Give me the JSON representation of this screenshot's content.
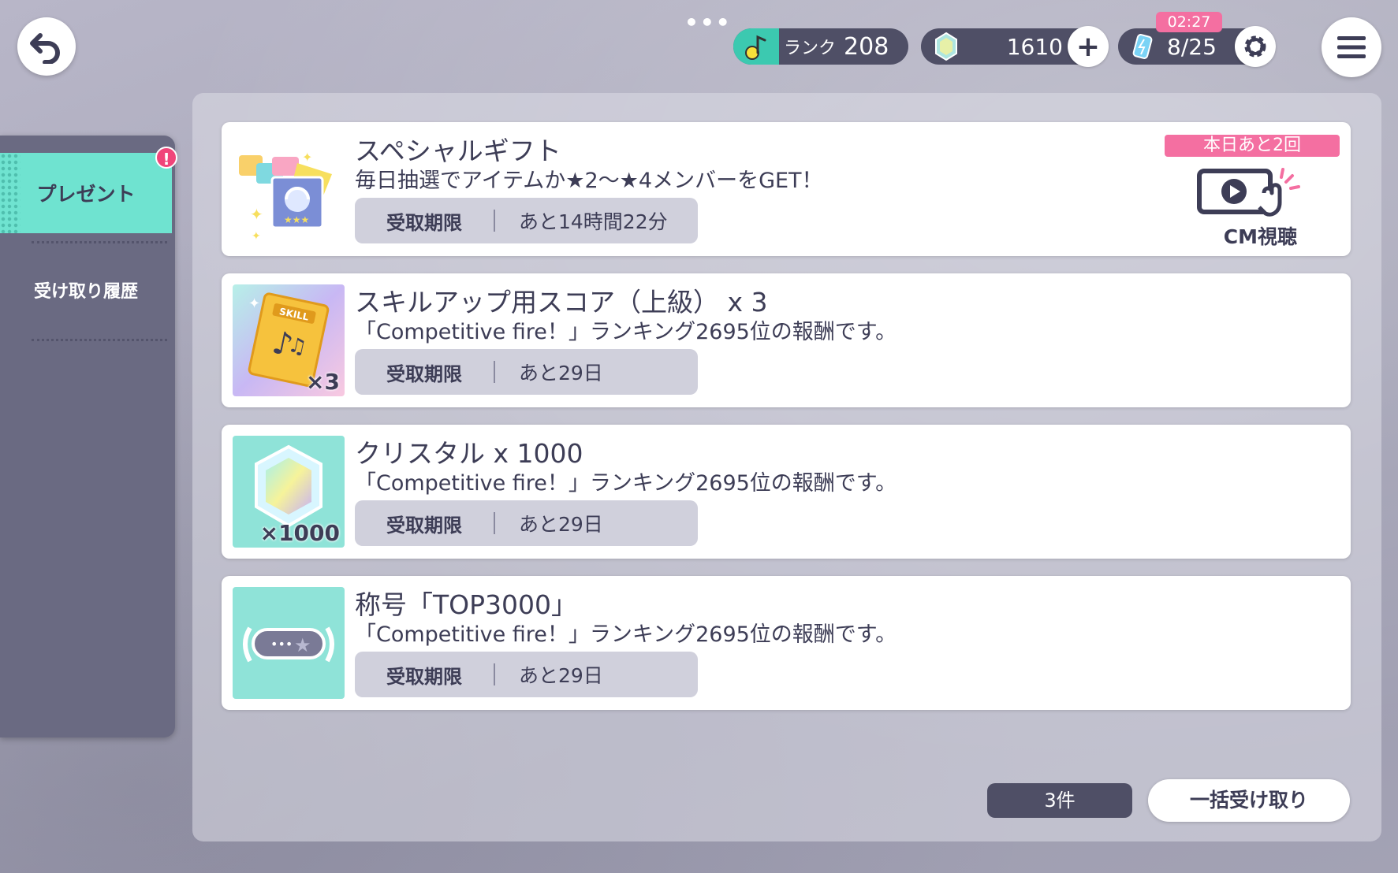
{
  "header": {
    "rank_label": "ランク",
    "rank_value": "208",
    "crystal_value": "1610",
    "energy_value": "8/25",
    "energy_timer": "02:27",
    "plus_label": "+"
  },
  "sidebar": {
    "active_tab": "プレゼント",
    "badge": "!",
    "history_tab": "受け取り履歴"
  },
  "cards": [
    {
      "title": "スペシャルギフト",
      "desc": "毎日抽選でアイテムか★2～★4メンバーをGET！",
      "deadline_label": "受取期限",
      "deadline_value": "あと14時間22分",
      "remaining": "本日あと2回",
      "cm_label": "CM視聴"
    },
    {
      "title": "スキルアップ用スコア（上級） x 3",
      "desc": "「Competitive fire！」ランキング2695位の報酬です。",
      "deadline_label": "受取期限",
      "deadline_value": "あと29日",
      "thumb_count": "×3",
      "thumb_text": "SKILL"
    },
    {
      "title": "クリスタル x 1000",
      "desc": "「Competitive fire！」ランキング2695位の報酬です。",
      "deadline_label": "受取期限",
      "deadline_value": "あと29日",
      "thumb_count": "×1000"
    },
    {
      "title": "称号「TOP3000」",
      "desc": "「Competitive fire！」ランキング2695位の報酬です。",
      "deadline_label": "受取期限",
      "deadline_value": "あと29日"
    }
  ],
  "footer": {
    "count": "3件",
    "bulk_receive": "一括受け取り"
  },
  "colors": {
    "accent_teal": "#6fe3d0",
    "accent_pink": "#f46fa1",
    "dark": "#4f4f66"
  },
  "icons": [
    "back-arrow-icon",
    "music-note-icon",
    "crystal-icon",
    "plus-icon",
    "energy-icon",
    "gear-icon",
    "menu-icon",
    "cm-video-icon"
  ]
}
